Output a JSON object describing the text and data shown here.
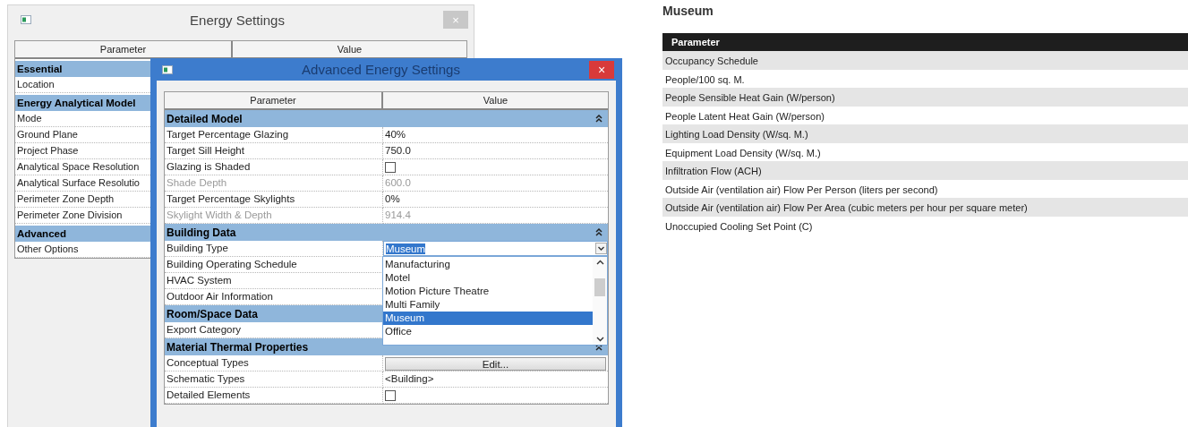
{
  "energy_settings_window": {
    "title": "Energy Settings",
    "close_button": "×",
    "columns": [
      "Parameter",
      "Value"
    ],
    "groups": [
      {
        "title": "Essential",
        "rows": [
          "Location"
        ]
      },
      {
        "title": "Energy Analytical Model",
        "rows": [
          "Mode",
          "Ground Plane",
          "Project Phase",
          "Analytical Space Resolution",
          "Analytical Surface Resolutio",
          "Perimeter Zone Depth",
          "Perimeter Zone Division"
        ]
      },
      {
        "title": "Advanced",
        "rows": [
          "Other Options"
        ]
      }
    ]
  },
  "advanced_window": {
    "title": "Advanced Energy Settings",
    "close_button": "×",
    "columns": [
      "Parameter",
      "Value"
    ],
    "groups": [
      {
        "title": "Detailed Model",
        "expanded": true,
        "rows": [
          {
            "label": "Target Percentage Glazing",
            "kind": "text",
            "value": "40%",
            "disabled": false
          },
          {
            "label": "Target Sill Height",
            "kind": "text",
            "value": "750.0",
            "disabled": false
          },
          {
            "label": "Glazing is Shaded",
            "kind": "checkbox",
            "checked": false,
            "disabled": false
          },
          {
            "label": "Shade Depth",
            "kind": "text",
            "value": "600.0",
            "disabled": true
          },
          {
            "label": "Target Percentage Skylights",
            "kind": "text",
            "value": "0%",
            "disabled": false
          },
          {
            "label": "Skylight Width & Depth",
            "kind": "text",
            "value": "914.4",
            "disabled": true
          }
        ]
      },
      {
        "title": "Building Data",
        "expanded": true,
        "rows": [
          {
            "label": "Building Type",
            "kind": "dropdown",
            "value": "Museum",
            "disabled": false,
            "open": true,
            "options": [
              {
                "label": "Manufacturing",
                "selected": false
              },
              {
                "label": "Motel",
                "selected": false
              },
              {
                "label": "Motion Picture Theatre",
                "selected": false
              },
              {
                "label": "Multi Family",
                "selected": false
              },
              {
                "label": "Museum",
                "selected": true
              },
              {
                "label": "Office",
                "selected": false
              }
            ]
          },
          {
            "label": "Building Operating Schedule",
            "kind": "hidden",
            "disabled": false
          },
          {
            "label": "HVAC System",
            "kind": "hidden",
            "disabled": false
          },
          {
            "label": "Outdoor Air Information",
            "kind": "hidden",
            "disabled": false
          }
        ]
      },
      {
        "title": "Room/Space Data",
        "rows": [
          {
            "label": "Export Category",
            "kind": "hidden",
            "disabled": false
          }
        ]
      },
      {
        "title": "Material Thermal Properties",
        "expanded": true,
        "rows": [
          {
            "label": "Conceptual Types",
            "kind": "button",
            "value": "Edit...",
            "disabled": false
          },
          {
            "label": "Schematic Types",
            "kind": "text",
            "value": "<Building>",
            "disabled": false
          },
          {
            "label": "Detailed Elements",
            "kind": "checkbox",
            "checked": false,
            "disabled": false
          }
        ]
      }
    ]
  },
  "museum_panel": {
    "title": "Museum",
    "table": {
      "columns": [
        "Parameter"
      ],
      "rows": [
        "Occupancy Schedule",
        "People/100 sq. M.",
        "People Sensible Heat Gain (W/person)",
        "People Latent Heat Gain (W/person)",
        "Lighting Load Density (W/sq. M.)",
        "Equipment Load Density (W/sq. M.)",
        "Infiltration Flow (ACH)",
        "Outside Air (ventilation air) Flow Per Person (liters per second)",
        "Outside Air (ventilation air) Flow Per Area (cubic meters per hour per square meter)",
        "Unoccupied Cooling Set Point (C)"
      ]
    }
  }
}
